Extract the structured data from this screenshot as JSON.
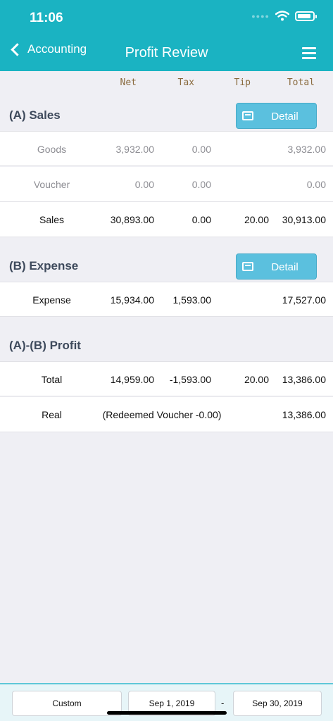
{
  "status": {
    "time": "11:06"
  },
  "nav": {
    "back_label": "Accounting",
    "title": "Profit Review"
  },
  "columns": [
    "Net",
    "Tax",
    "Tip",
    "Total"
  ],
  "sales": {
    "title": "(A) Sales",
    "detail_label": "Detail",
    "rows": [
      {
        "label": "Goods",
        "net": "3,932.00",
        "tax": "0.00",
        "tip": "",
        "total": "3,932.00"
      },
      {
        "label": "Voucher",
        "net": "0.00",
        "tax": "0.00",
        "tip": "",
        "total": "0.00"
      },
      {
        "label": "Sales",
        "net": "30,893.00",
        "tax": "0.00",
        "tip": "20.00",
        "total": "30,913.00"
      }
    ]
  },
  "expense": {
    "title": "(B) Expense",
    "detail_label": "Detail",
    "rows": [
      {
        "label": "Expense",
        "net": "15,934.00",
        "tax": "1,593.00",
        "tip": "",
        "total": "17,527.00"
      }
    ]
  },
  "profit": {
    "title": "(A)-(B) Profit",
    "total_row": {
      "label": "Total",
      "net": "14,959.00",
      "tax": "-1,593.00",
      "tip": "20.00",
      "total": "13,386.00"
    },
    "real_row": {
      "label": "Real",
      "note": "(Redeemed Voucher -0.00)",
      "total": "13,386.00"
    }
  },
  "footer": {
    "range_label": "Custom",
    "start_date": "Sep 1, 2019",
    "separator": "-",
    "end_date": "Sep 30, 2019"
  }
}
